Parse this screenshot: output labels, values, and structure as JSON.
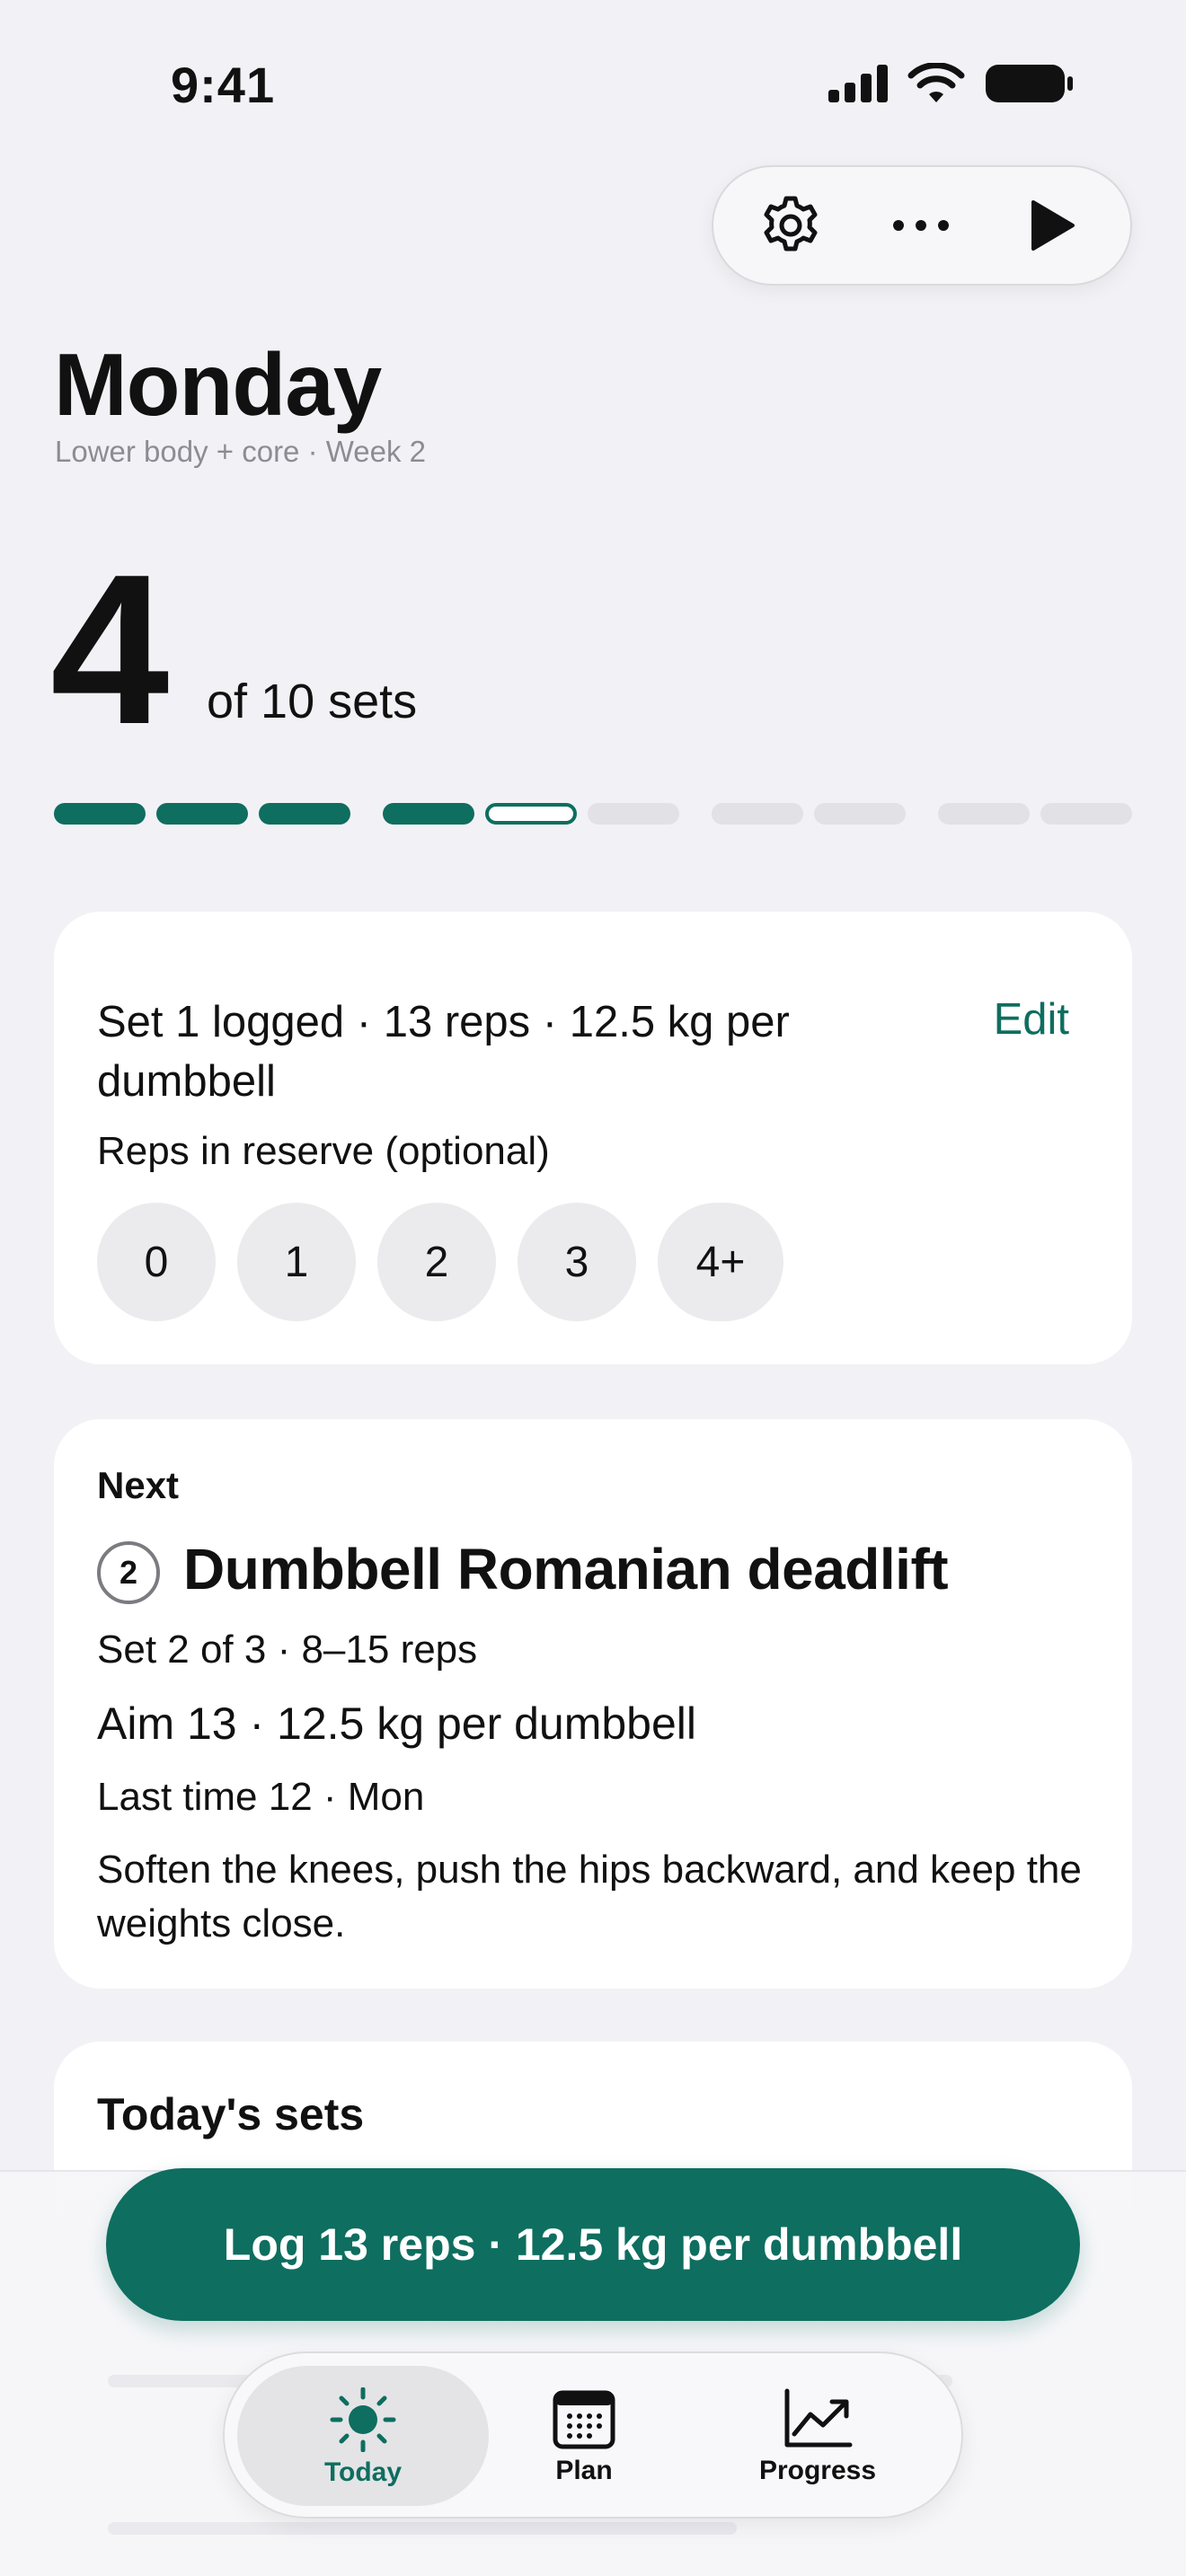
{
  "status_bar": {
    "time": "9:41"
  },
  "toolbar": {
    "settings_icon": "gear-icon",
    "more_icon": "ellipsis-icon",
    "play_icon": "play-icon"
  },
  "header": {
    "title": "Monday",
    "subtitle": "Lower body + core · Week 2"
  },
  "progress": {
    "count": "4",
    "suffix": "of 10 sets",
    "completed": 4,
    "total": 10,
    "current_index": 4
  },
  "logged_card": {
    "text": "Set 1 logged · 13 reps · 12.5 kg per dumbbell",
    "edit_label": "Edit",
    "rir_label": "Reps in reserve (optional)",
    "rir_options": [
      "0",
      "1",
      "2",
      "3",
      "4+"
    ]
  },
  "next_card": {
    "label": "Next",
    "number": "2",
    "exercise": "Dumbbell Romanian deadlift",
    "set_info": "Set 2 of 3 · 8–15 reps",
    "aim": "Aim 13 · 12.5 kg per dumbbell",
    "last_time": "Last time 12 · Mon",
    "tip": "Soften the knees, push the hips backward, and keep the weights close."
  },
  "sets_card": {
    "title": "Today's sets"
  },
  "log_button": {
    "label": "Log 13 reps · 12.5 kg per dumbbell"
  },
  "tabs": [
    {
      "label": "Today",
      "icon": "sun-icon",
      "active": true
    },
    {
      "label": "Plan",
      "icon": "calendar-icon",
      "active": false
    },
    {
      "label": "Progress",
      "icon": "chart-icon",
      "active": false
    }
  ],
  "colors": {
    "accent": "#0e6e5f",
    "background": "#f2f2f6",
    "card": "#ffffff"
  }
}
